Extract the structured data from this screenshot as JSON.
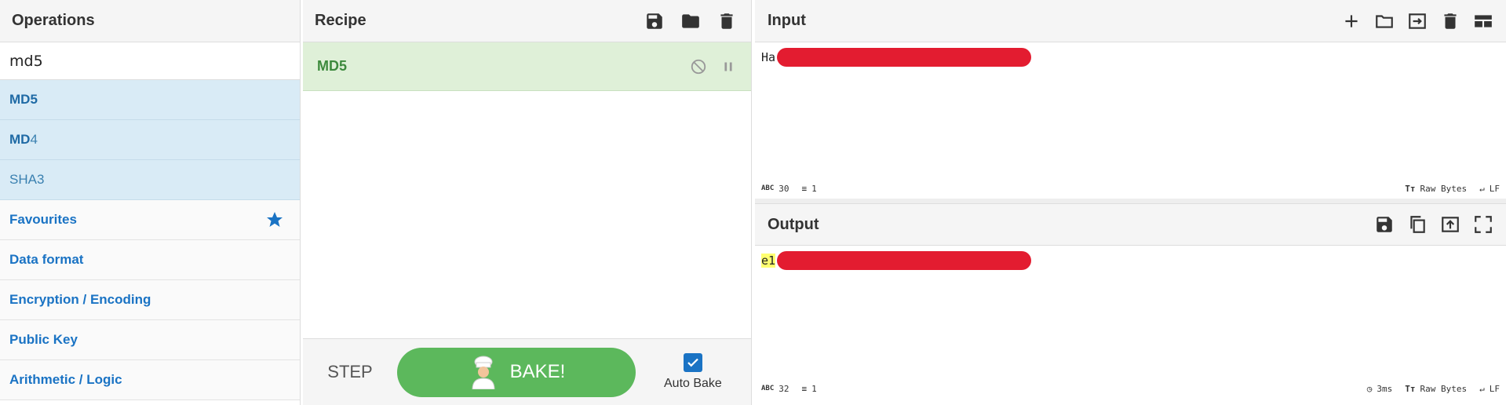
{
  "operations": {
    "title": "Operations",
    "search_value": "md5",
    "results": [
      {
        "bold": "MD5",
        "rest": ""
      },
      {
        "bold": "MD",
        "rest": "4"
      },
      {
        "bold": "",
        "rest": "SHA3"
      }
    ],
    "categories": [
      "Favourites",
      "Data format",
      "Encryption / Encoding",
      "Public Key",
      "Arithmetic / Logic"
    ]
  },
  "recipe": {
    "title": "Recipe",
    "op_name": "MD5",
    "step_label": "STEP",
    "bake_label": "BAKE!",
    "auto_bake_label": "Auto Bake"
  },
  "input": {
    "title": "Input",
    "text": "Ha",
    "stats": {
      "chars": "30",
      "lines": "1",
      "encoding": "Raw Bytes",
      "eol": "LF"
    }
  },
  "output": {
    "title": "Output",
    "text": "e1",
    "stats": {
      "chars": "32",
      "lines": "1",
      "time": "3ms",
      "encoding": "Raw Bytes",
      "eol": "LF"
    }
  },
  "colors": {
    "accent": "#1a73c4",
    "bake": "#5cb85c",
    "recipe_op": "#dff0d8",
    "redaction": "#e31c30"
  }
}
